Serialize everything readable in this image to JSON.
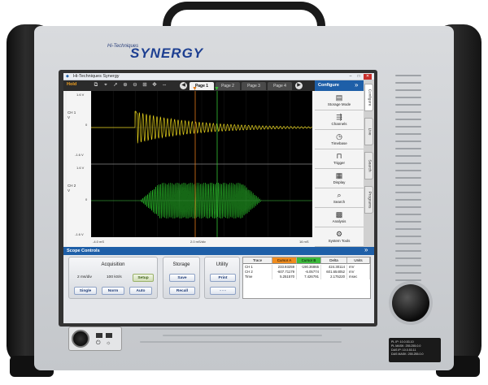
{
  "brand": {
    "small": "Hi-Techniques",
    "name": "SYNERGY"
  },
  "window": {
    "title": "Hi-Techniques Synergy",
    "min": "–",
    "max": "□",
    "close": "✕"
  },
  "toolbar": {
    "hold": "Hold",
    "pages": [
      "Page 1",
      "Page 2",
      "Page 3",
      "Page 4"
    ],
    "prev": "◀",
    "next": "▶"
  },
  "channels": [
    {
      "name": "CH 1",
      "unit": "V",
      "top": "1.6 V",
      "zero": "0",
      "bottom": "-1.6 V"
    },
    {
      "name": "CH 2",
      "unit": "V",
      "top": "1.6 V",
      "zero": "0",
      "bottom": "-1.6 V"
    }
  ],
  "time_axis": {
    "left": "-4.0 mS",
    "center": "2.0 mS/div",
    "right": "16 mS"
  },
  "colors": {
    "ch1": "#e6d21c",
    "ch2": "#2ed12e",
    "cursor_a": "#e07a1a",
    "cursor_b": "#35c235",
    "accent": "#1e5fa8"
  },
  "configure": {
    "title": "Configure",
    "arrow": "»",
    "items": [
      {
        "label": "Storage Mode",
        "icon": "storage-mode-icon",
        "glyph": "▤"
      },
      {
        "label": "Channels",
        "icon": "channels-icon",
        "glyph": "⇶"
      },
      {
        "label": "Timebase",
        "icon": "clock-icon",
        "glyph": "◷"
      },
      {
        "label": "Trigger",
        "icon": "trigger-icon",
        "glyph": "⊓"
      },
      {
        "label": "Display",
        "icon": "display-icon",
        "glyph": "▦"
      },
      {
        "label": "Search",
        "icon": "search-icon",
        "glyph": "⌕"
      },
      {
        "label": "Analysis",
        "icon": "analysis-icon",
        "glyph": "▩"
      },
      {
        "label": "System Tools",
        "icon": "gear-icon",
        "glyph": "⚙"
      }
    ]
  },
  "side_tabs": [
    "Configure",
    "Live",
    "Search",
    "Programs"
  ],
  "scope_controls": {
    "title": "Scope Controls",
    "arrow": "»",
    "acquisition": {
      "title": "Acquisition",
      "time_div": "2 ms/div",
      "rate": "100 kS/s",
      "setup": "Setup",
      "single": "Single",
      "norm": "Norm",
      "auto": "Auto"
    },
    "storage": {
      "title": "Storage",
      "save": "Save",
      "recall": "Recall"
    },
    "utility": {
      "title": "Utility",
      "print": "Print",
      "more": "- - -"
    },
    "cursors": {
      "headers": [
        "Trace",
        "Cursor A",
        "Cursor B",
        "Delta",
        "Units"
      ],
      "rows": [
        [
          "CH 1",
          "233.93259",
          "-190.36865",
          "424.30114",
          "mV"
        ],
        [
          "CH 2",
          "-607.71179",
          "-6.05774",
          "601.654052",
          "mV"
        ],
        [
          "Time",
          "5.251570",
          "7.426791",
          "2.175220",
          "msec"
        ]
      ]
    }
  },
  "device_label": [
    "PL IP: 10.0.53.10",
    "PL MASK: 255.255.0.0",
    "DAS IP: 10.0.53.11",
    "DAS MASK: 255.255.0.0"
  ],
  "panel_glyphs": {
    "power": "⏻",
    "sun": "☼"
  }
}
